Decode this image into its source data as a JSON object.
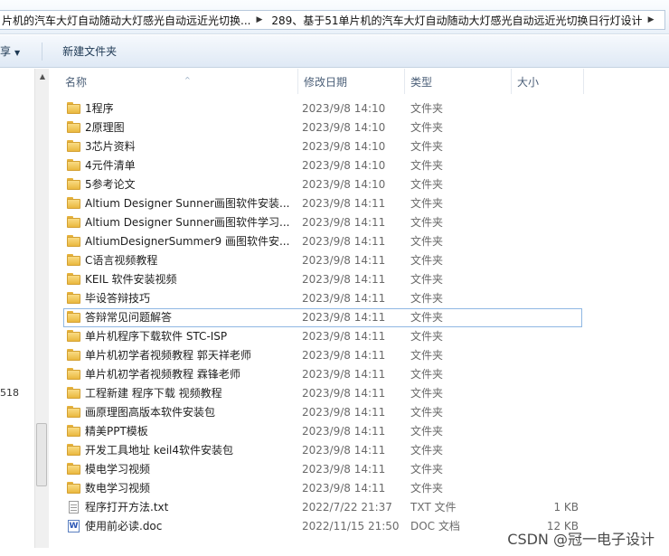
{
  "breadcrumb": {
    "items": [
      "片机的汽车大灯自动随动大灯感光自动远近光切换...",
      "289、基于51单片机的汽车大灯自动随动大灯感光自动远近光切换日行灯设计"
    ],
    "arrow": "▶"
  },
  "toolbar": {
    "share_label": "享",
    "share_caret": "▼",
    "new_folder_label": "新建文件夹"
  },
  "navpane": {
    "partial_text": "518"
  },
  "columns": {
    "name": "名称",
    "date": "修改日期",
    "type": "类型",
    "size": "大小",
    "sort_arrow": "^"
  },
  "files": [
    {
      "name": "1程序",
      "date": "2023/9/8 14:10",
      "type": "文件夹",
      "size": "",
      "icon": "folder-icon"
    },
    {
      "name": "2原理图",
      "date": "2023/9/8 14:10",
      "type": "文件夹",
      "size": "",
      "icon": "folder-icon"
    },
    {
      "name": "3芯片资料",
      "date": "2023/9/8 14:10",
      "type": "文件夹",
      "size": "",
      "icon": "folder-icon"
    },
    {
      "name": "4元件清单",
      "date": "2023/9/8 14:10",
      "type": "文件夹",
      "size": "",
      "icon": "folder-icon"
    },
    {
      "name": "5参考论文",
      "date": "2023/9/8 14:10",
      "type": "文件夹",
      "size": "",
      "icon": "folder-icon"
    },
    {
      "name": "Altium Designer Sunner画图软件安装...",
      "date": "2023/9/8 14:11",
      "type": "文件夹",
      "size": "",
      "icon": "folder-icon"
    },
    {
      "name": "Altium Designer Sunner画图软件学习...",
      "date": "2023/9/8 14:11",
      "type": "文件夹",
      "size": "",
      "icon": "folder-icon"
    },
    {
      "name": "AltiumDesignerSummer9 画图软件安...",
      "date": "2023/9/8 14:11",
      "type": "文件夹",
      "size": "",
      "icon": "folder-icon"
    },
    {
      "name": "C语言视频教程",
      "date": "2023/9/8 14:11",
      "type": "文件夹",
      "size": "",
      "icon": "folder-icon"
    },
    {
      "name": "KEIL 软件安装视频",
      "date": "2023/9/8 14:11",
      "type": "文件夹",
      "size": "",
      "icon": "folder-icon"
    },
    {
      "name": "毕设答辩技巧",
      "date": "2023/9/8 14:11",
      "type": "文件夹",
      "size": "",
      "icon": "folder-icon"
    },
    {
      "name": "答辩常见问题解答",
      "date": "2023/9/8 14:11",
      "type": "文件夹",
      "size": "",
      "icon": "folder-icon",
      "selected": true
    },
    {
      "name": "单片机程序下载软件 STC-ISP",
      "date": "2023/9/8 14:11",
      "type": "文件夹",
      "size": "",
      "icon": "folder-icon"
    },
    {
      "name": "单片机初学者视频教程 郭天祥老师",
      "date": "2023/9/8 14:11",
      "type": "文件夹",
      "size": "",
      "icon": "folder-icon"
    },
    {
      "name": "单片机初学者视频教程 霖锋老师",
      "date": "2023/9/8 14:11",
      "type": "文件夹",
      "size": "",
      "icon": "folder-icon"
    },
    {
      "name": "工程新建  程序下载 视频教程",
      "date": "2023/9/8 14:11",
      "type": "文件夹",
      "size": "",
      "icon": "folder-icon"
    },
    {
      "name": "画原理图高版本软件安装包",
      "date": "2023/9/8 14:11",
      "type": "文件夹",
      "size": "",
      "icon": "folder-icon"
    },
    {
      "name": "精美PPT模板",
      "date": "2023/9/8 14:11",
      "type": "文件夹",
      "size": "",
      "icon": "folder-icon"
    },
    {
      "name": "开发工具地址 keil4软件安装包",
      "date": "2023/9/8 14:11",
      "type": "文件夹",
      "size": "",
      "icon": "folder-icon"
    },
    {
      "name": "模电学习视频",
      "date": "2023/9/8 14:11",
      "type": "文件夹",
      "size": "",
      "icon": "folder-icon"
    },
    {
      "name": "数电学习视频",
      "date": "2023/9/8 14:11",
      "type": "文件夹",
      "size": "",
      "icon": "folder-icon"
    },
    {
      "name": "程序打开方法.txt",
      "date": "2022/7/22 21:37",
      "type": "TXT 文件",
      "size": "1 KB",
      "icon": "txt-file-icon"
    },
    {
      "name": "使用前必读.doc",
      "date": "2022/11/15 21:50",
      "type": "DOC 文档",
      "size": "12 KB",
      "icon": "doc-file-icon"
    }
  ],
  "watermark": "CSDN @冠一电子设计"
}
